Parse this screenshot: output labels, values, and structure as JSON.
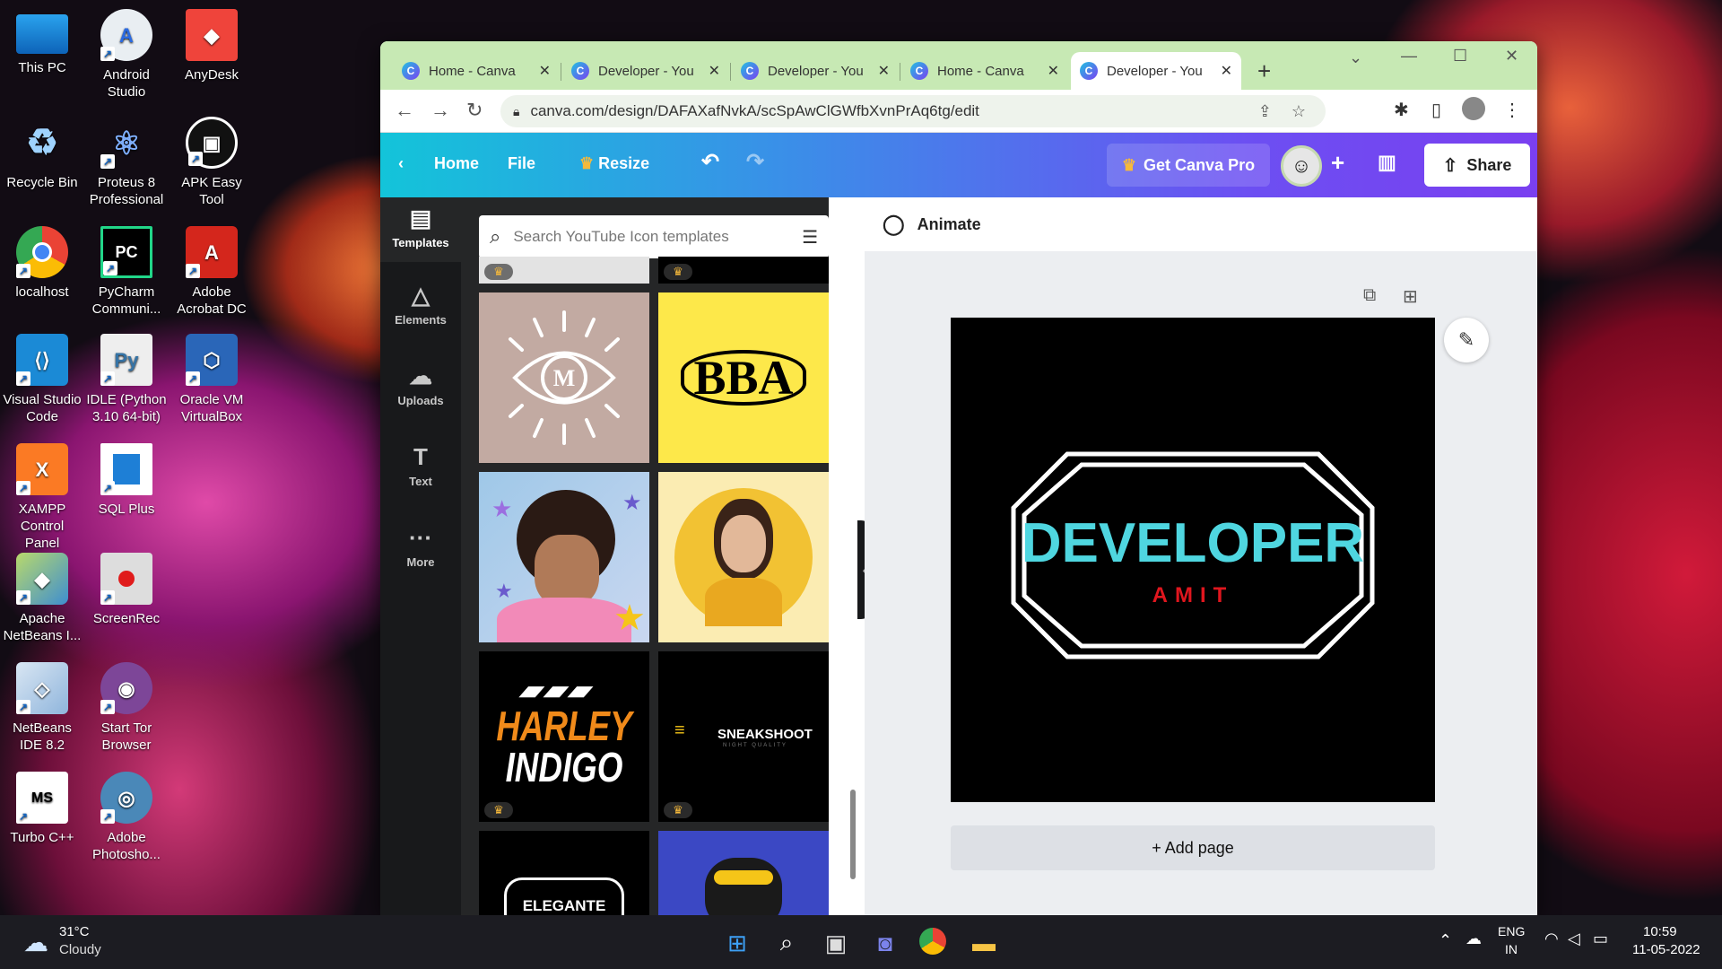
{
  "desktop": {
    "icons": [
      {
        "label": "This PC"
      },
      {
        "label": "Android Studio"
      },
      {
        "label": "AnyDesk"
      },
      {
        "label": "Recycle Bin"
      },
      {
        "label": "Proteus 8 Professional"
      },
      {
        "label": "APK Easy Tool"
      },
      {
        "label": "localhost"
      },
      {
        "label": "PyCharm Communi..."
      },
      {
        "label": "Adobe Acrobat DC"
      },
      {
        "label": "Visual Studio Code"
      },
      {
        "label": "IDLE (Python 3.10 64-bit)"
      },
      {
        "label": "Oracle VM VirtualBox"
      },
      {
        "label": "XAMPP Control Panel"
      },
      {
        "label": "SQL Plus"
      },
      {
        "label": "Apache NetBeans I..."
      },
      {
        "label": "ScreenRec"
      },
      {
        "label": "NetBeans IDE 8.2"
      },
      {
        "label": "Start Tor Browser"
      },
      {
        "label": "Turbo C++"
      },
      {
        "label": "Adobe Photosho..."
      }
    ]
  },
  "browser": {
    "tabs": [
      {
        "title": "Home - Canva"
      },
      {
        "title": "Developer - You"
      },
      {
        "title": "Developer - You"
      },
      {
        "title": "Home - Canva"
      },
      {
        "title": "Developer - You"
      }
    ],
    "url": "canva.com/design/DAFAXafNvkA/scSpAwClGWfbXvnPrAq6tg/edit"
  },
  "canva": {
    "header": {
      "home": "Home",
      "file": "File",
      "resize": "Resize",
      "get_pro": "Get Canva Pro",
      "share": "Share"
    },
    "rail": [
      {
        "label": "Templates"
      },
      {
        "label": "Elements"
      },
      {
        "label": "Uploads"
      },
      {
        "label": "Text"
      },
      {
        "label": "More"
      }
    ],
    "search_placeholder": "Search YouTube Icon templates",
    "templates": {
      "bba": "BBA",
      "harley_line1": "HARLEY",
      "harley_line2": "INDIGO",
      "sneakshoot": "SNEAKSHOOT",
      "sneakshoot_sub": "NIGHT QUALITY",
      "elegante": "ELEGANTE",
      "eye_letter": "M"
    },
    "animate": "Animate",
    "design": {
      "title": "DEVELOPER",
      "subtitle": "AMIT"
    },
    "add_page": "+ Add page"
  },
  "taskbar": {
    "temp": "31°C",
    "weather": "Cloudy",
    "lang1": "ENG",
    "lang2": "IN",
    "time": "10:59",
    "date": "11-05-2022"
  },
  "colors": {
    "design_title": "#4fd6e0",
    "design_subtitle": "#e0161e",
    "tab_strip": "#c7e9b4",
    "crown": "#f6b93b"
  }
}
